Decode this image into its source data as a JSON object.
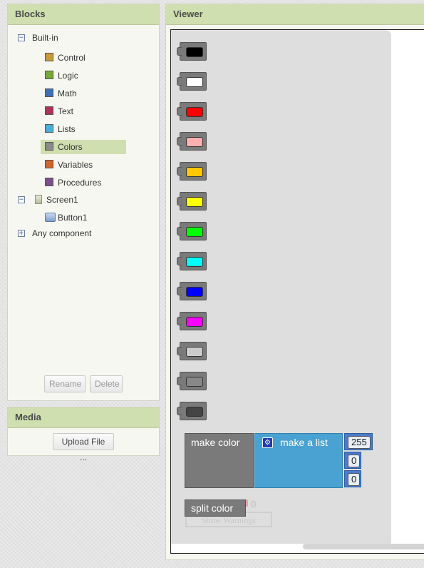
{
  "blocks_panel": {
    "title": "Blocks",
    "builtin": {
      "label": "Built-in",
      "toggle": "−",
      "categories": [
        {
          "label": "Control",
          "color": "#c69c3b"
        },
        {
          "label": "Logic",
          "color": "#77a83a"
        },
        {
          "label": "Math",
          "color": "#3f6fb5"
        },
        {
          "label": "Text",
          "color": "#b0315b"
        },
        {
          "label": "Lists",
          "color": "#4aaed8"
        },
        {
          "label": "Colors",
          "color": "#8a8a8a"
        },
        {
          "label": "Variables",
          "color": "#d0642b"
        },
        {
          "label": "Procedures",
          "color": "#7d4f8a"
        }
      ],
      "selected": "Colors"
    },
    "screen": {
      "label": "Screen1",
      "toggle": "−",
      "icon": "screen-icon"
    },
    "button1": {
      "label": "Button1",
      "icon": "button-icon"
    },
    "any_component": {
      "label": "Any component",
      "toggle": "+"
    },
    "rename_label": "Rename",
    "delete_label": "Delete"
  },
  "media_panel": {
    "title": "Media",
    "upload_label": "Upload File ..."
  },
  "viewer": {
    "title": "Viewer",
    "color_blocks": [
      {
        "name": "black",
        "color": "#000000"
      },
      {
        "name": "white",
        "color": "#ffffff"
      },
      {
        "name": "red",
        "color": "#ff0000"
      },
      {
        "name": "pink",
        "color": "#ffafaf"
      },
      {
        "name": "orange",
        "color": "#ffc800"
      },
      {
        "name": "yellow",
        "color": "#ffff00"
      },
      {
        "name": "green",
        "color": "#00ff00"
      },
      {
        "name": "cyan",
        "color": "#00ffff"
      },
      {
        "name": "blue",
        "color": "#0000ff"
      },
      {
        "name": "magenta",
        "color": "#ff00ff"
      },
      {
        "name": "light-gray",
        "color": "#cccccc"
      },
      {
        "name": "gray",
        "color": "#888888"
      },
      {
        "name": "dark-gray",
        "color": "#444444"
      }
    ],
    "make_color_label": "make color",
    "make_list_label": "make a list",
    "list_values": [
      "255",
      "0",
      "0"
    ],
    "split_color_label": "split color",
    "warning_count": "0",
    "show_warnings_label": "Show Warnings"
  }
}
